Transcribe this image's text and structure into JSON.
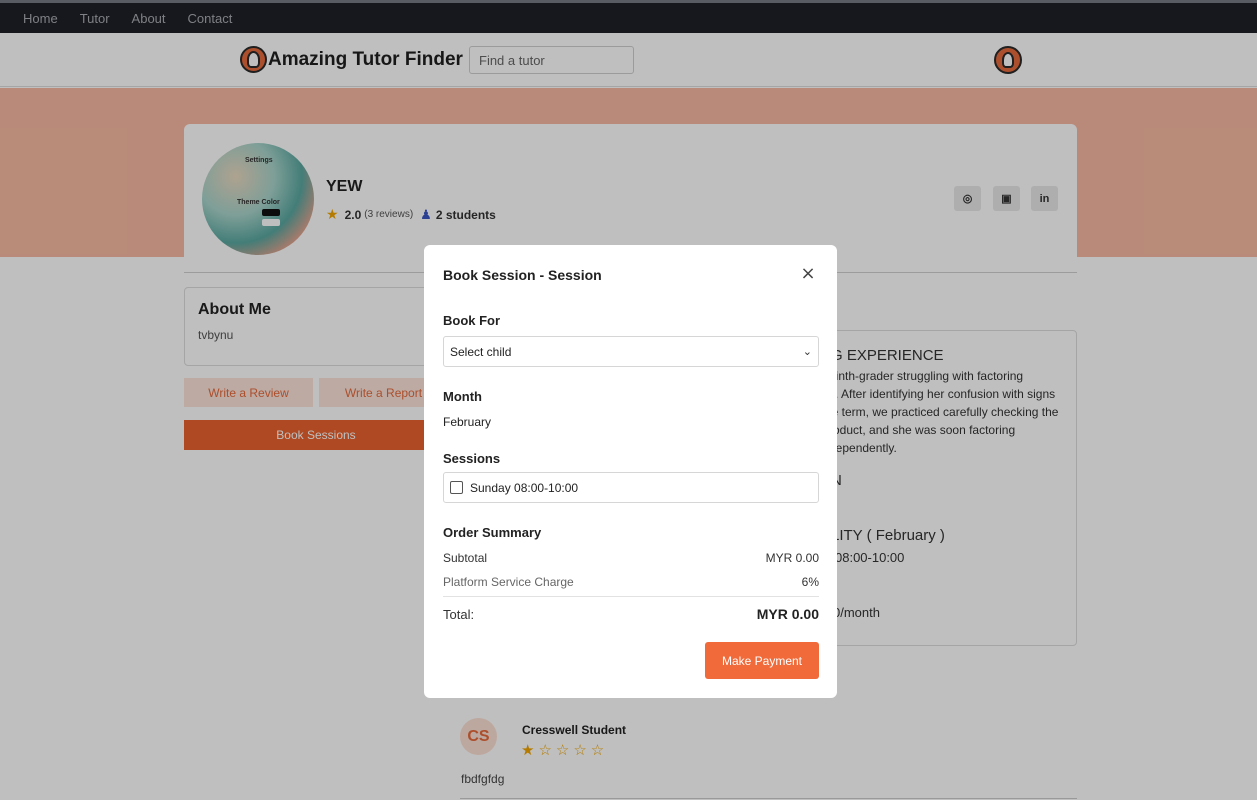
{
  "nav": {
    "items": [
      "Home",
      "Tutor",
      "About",
      "Contact"
    ]
  },
  "header": {
    "brand": "Amazing Tutor Finder",
    "search_placeholder": "Find a tutor"
  },
  "profile": {
    "name": "YEW",
    "rating": "2.0",
    "reviews": "(3 reviews)",
    "students": "2 students",
    "pic_labels": {
      "settings": "Settings",
      "theme": "Theme Color"
    },
    "social": [
      "whatsapp-icon",
      "instagram-icon",
      "linkedin-icon"
    ]
  },
  "about": {
    "title": "About Me",
    "text": "tvbynu"
  },
  "actions": {
    "review": "Write a Review",
    "report": "Write a Report",
    "book": "Book Sessions"
  },
  "experience": {
    "heading": "G EXPERIENCE",
    "lines": [
      "ninth-grader struggling with factoring",
      "s. After identifying her confusion with signs",
      "le term, we practiced carefully checking the",
      "roduct, and she was soon factoring",
      "dependently."
    ],
    "heading2": "N",
    "avail_heading": "LITY ( February )",
    "avail_time": "08:00-10:00",
    "rate": "0/month"
  },
  "review": {
    "initials": "CS",
    "name": "Cresswell Student",
    "stars": "★☆☆☆☆",
    "text": "fbdfgfdg"
  },
  "modal": {
    "title": "Book Session - Session",
    "close": "×",
    "book_for_label": "Book For",
    "select_value": "Select child",
    "month_label": "Month",
    "month_value": "February",
    "sessions_label": "Sessions",
    "session_option": "Sunday 08:00-10:00",
    "summary_label": "Order Summary",
    "subtotal_label": "Subtotal",
    "subtotal_value": "MYR 0.00",
    "service_label": "Platform Service Charge",
    "service_value": "6%",
    "total_label": "Total:",
    "total_value": "MYR 0.00",
    "pay_button": "Make Payment"
  },
  "colors": {
    "accent": "#e8622f",
    "banner": "#f7b9a2",
    "nav_bg": "#1f2029"
  }
}
